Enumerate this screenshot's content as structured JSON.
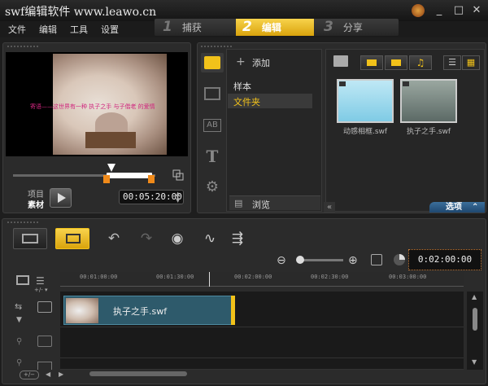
{
  "window": {
    "title": "swf编辑软件 www.leawo.cn",
    "controls": {
      "minimize": "_",
      "maximize": "□",
      "close": "✕"
    }
  },
  "menu": {
    "items": [
      "文件",
      "编辑",
      "工具",
      "设置"
    ]
  },
  "steps": [
    {
      "num": "1",
      "label": "捕获",
      "active": false
    },
    {
      "num": "2",
      "label": "编辑",
      "active": true
    },
    {
      "num": "3",
      "label": "分享",
      "active": false
    }
  ],
  "preview": {
    "caption": "寄语——这世界有一种 执子之手 与子偕老 的爱情",
    "mode_labels": {
      "project": "项目",
      "clip": "素材"
    },
    "timecode": "00:05:20:00"
  },
  "library": {
    "add_label": "添加",
    "folders": [
      {
        "label": "样本",
        "selected": false
      },
      {
        "label": "文件夹",
        "selected": true
      }
    ],
    "browse_label": "浏览",
    "thumbnails": [
      {
        "label": "动感相框.swf"
      },
      {
        "label": "执子之手.swf"
      }
    ],
    "options_label": "选项"
  },
  "timeline": {
    "timecode": "0:02:00:00",
    "ruler_ticks": [
      "00:01:00:00",
      "00:01:30:00",
      "00:02:00:00",
      "00:02:30:00",
      "00:03:00:00"
    ],
    "clip_label": "执子之手.swf"
  },
  "colors": {
    "accent": "#f2c21a",
    "selection": "#3a3a3a",
    "options_button": "#2a5a85"
  }
}
